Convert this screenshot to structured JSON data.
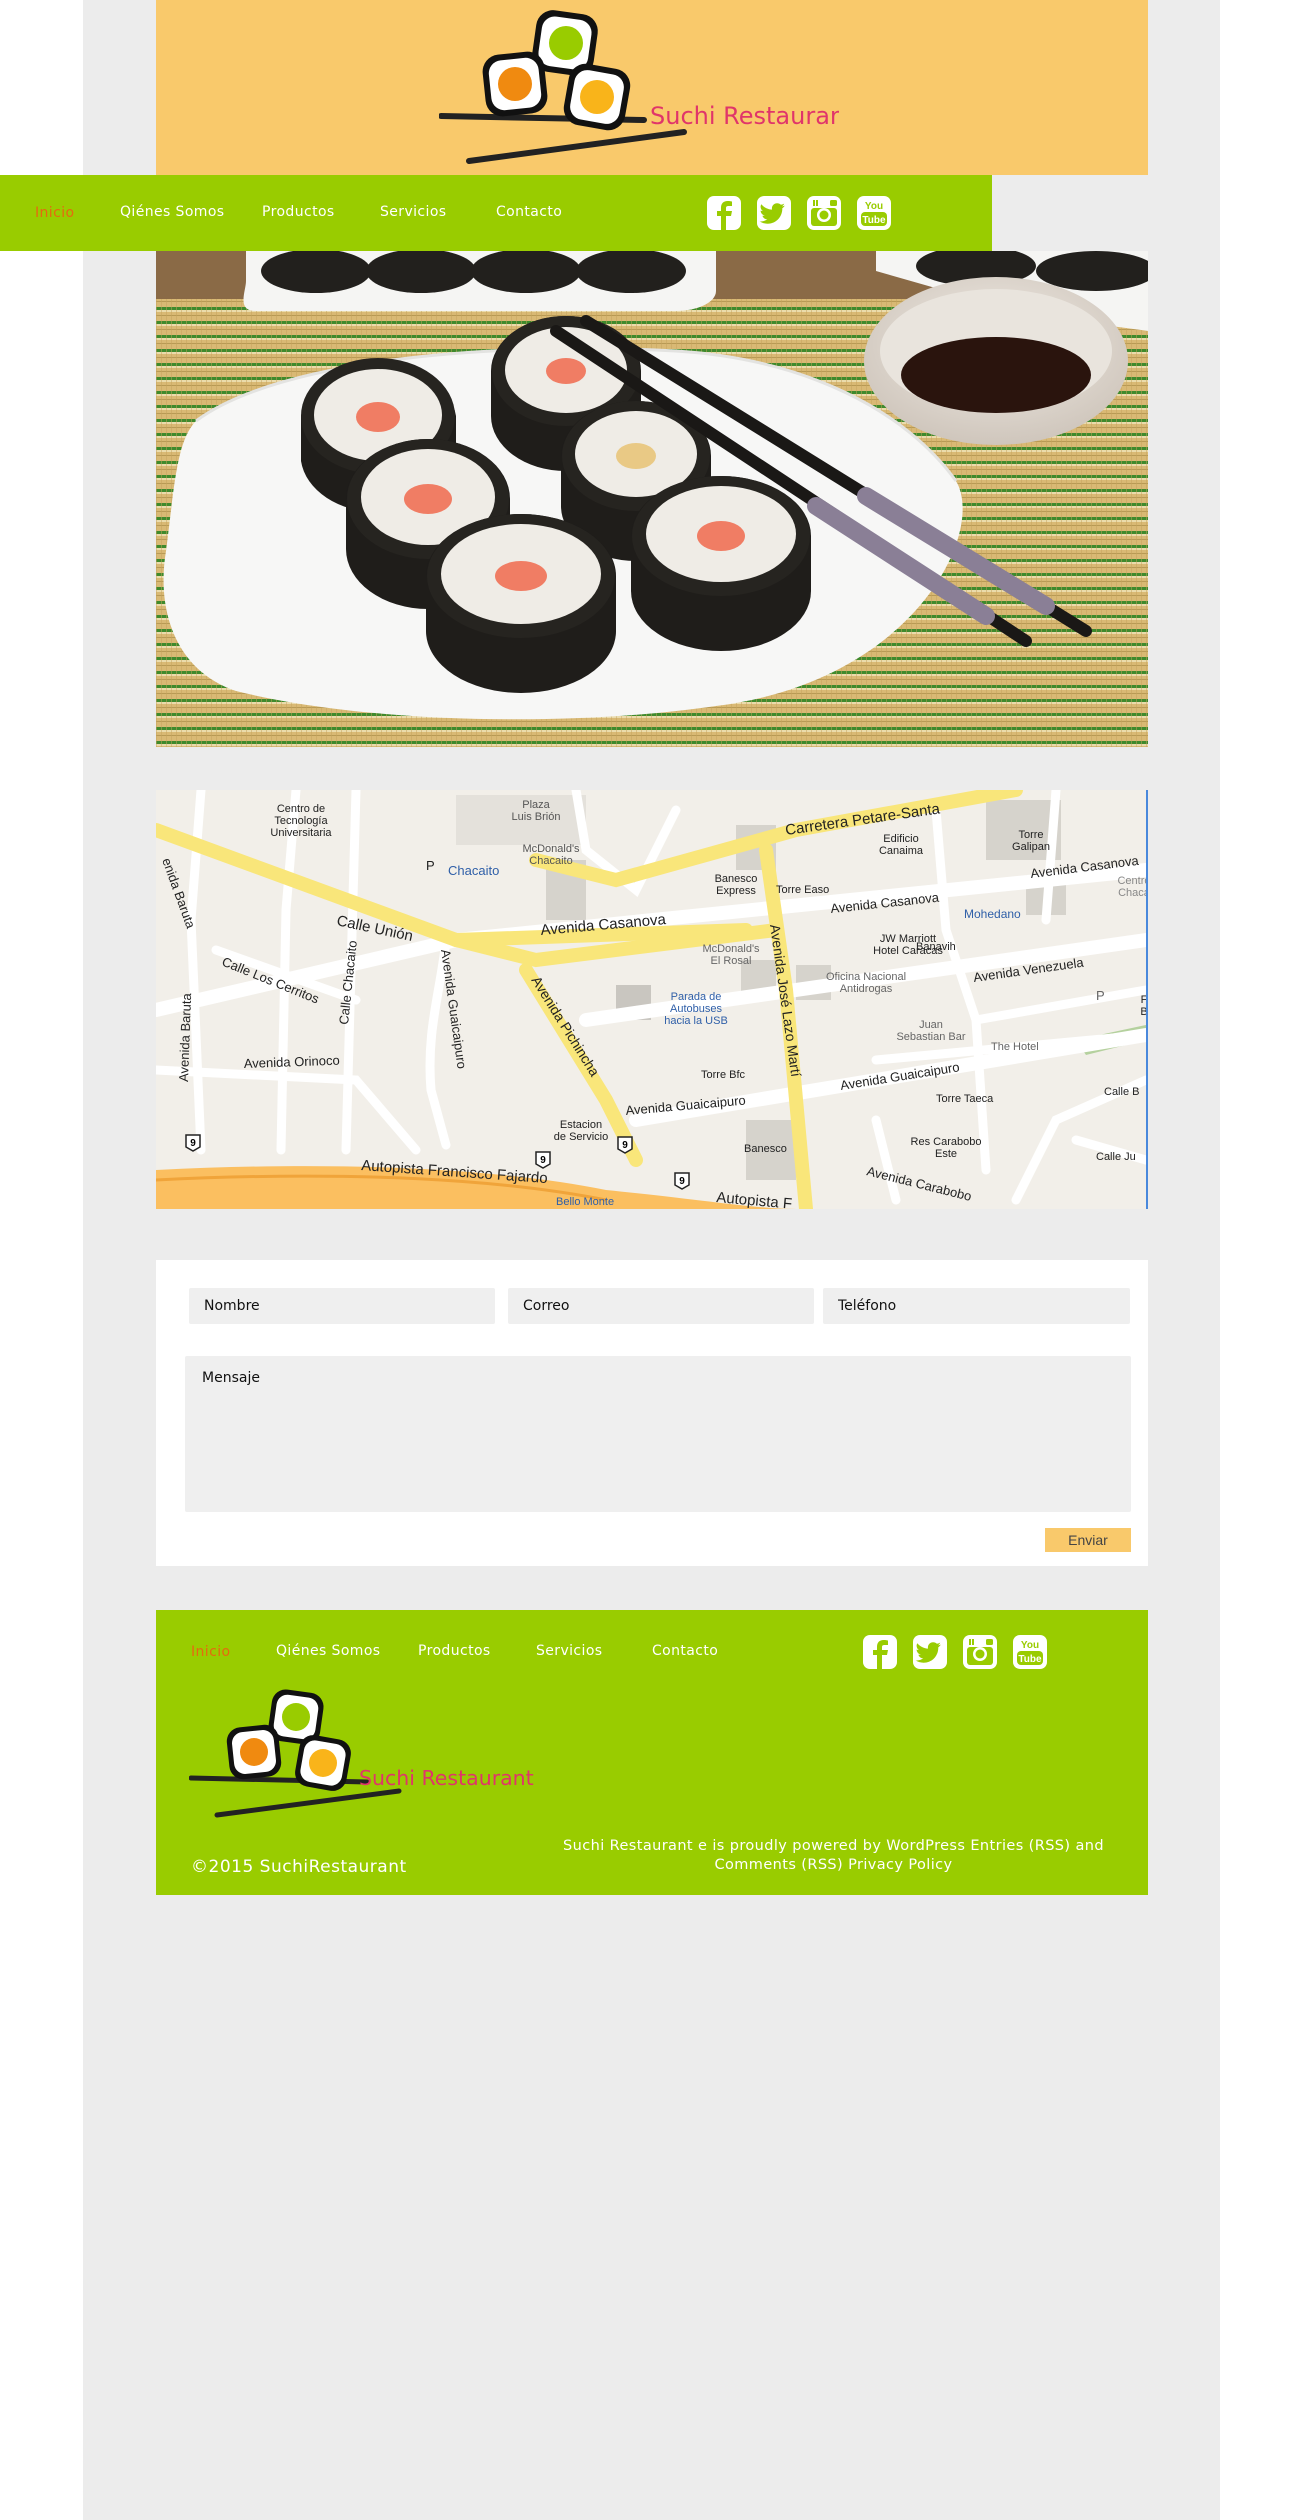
{
  "brand": {
    "name": "Suchi Restaurant",
    "colors": {
      "header": "#f9c96b",
      "nav": "#99cc00",
      "active": "#e56a0f",
      "logo_text": "#e0356a"
    }
  },
  "nav": {
    "items": [
      {
        "label": "Inicio",
        "active": true
      },
      {
        "label": "Qiénes Somos"
      },
      {
        "label": "Productos"
      },
      {
        "label": "Servicios"
      },
      {
        "label": "Contacto"
      }
    ],
    "social": [
      "facebook-icon",
      "twitter-icon",
      "instagram-icon",
      "youtube-icon"
    ],
    "youtube_text": {
      "line1": "You",
      "line2": "Tube"
    }
  },
  "hero": {
    "icon": "sushi-photo"
  },
  "map": {
    "labels": {
      "calle_union": "Calle Unión",
      "av_casanova": "Avenida Casanova",
      "av_casanova_2": "Avenida Casanova",
      "av_casanova_3": "Avenida Casanova",
      "av_jose_lazo": "Avenida José Lazo Martí",
      "av_pichincha": "Avenida Pichincha",
      "av_guaicaipuro": "Avenida Guaicaipuro",
      "av_guaicaipuro_2": "Avenida Guaicaipuro",
      "av_guaicaipuro_3": "Avenida Guaicaipuro",
      "autopista": "Autopista Francisco Fajardo",
      "autopista_2": "Autopista F",
      "av_orinoco": "Avenida Orinoco",
      "av_venezuela": "Avenida Venezuela",
      "av_carabobo": "Avenida Carabobo",
      "av_baruta": "Avenida Baruta",
      "av_baruta_2": "enida Baruta",
      "calle_cerritos": "Calle Los Cerritos",
      "calle_chacaito": "Calle Chacaito",
      "carretera": "Carretera Petare-Santa",
      "chacaito": "Chacaito",
      "mcdonalds_chacaito": "McDonald's\nChacaito",
      "plaza": "Plaza\nLuis Brión",
      "centro_tec": "Centro de\nTecnología\nUniversitaria",
      "banesco_express": "Banesco\nExpress",
      "torre_easo": "Torre Easo",
      "edificio": "Edificio\nCanaima",
      "torre_galipan": "Torre\nGalipan",
      "mohedano": "Mohedano",
      "jw": "JW Marriott\nHotel Caracas",
      "mcdonalds_rosal": "McDonald's\nEl Rosal",
      "oficina": "Oficina Nacional\nAntidrogas",
      "banavih": "Banavih",
      "parada": "Parada de\nAutobuses\nhacia la USB",
      "juan": "Juan\nSebastian Bar",
      "the_hotel": "The Hotel",
      "torre_bfc": "Torre Bfc",
      "torre_taeca": "Torre Taeca",
      "estacion": "Estacion\nde Servicio",
      "banesco": "Banesco",
      "res_carabobo": "Res Carabobo\nEste",
      "bello_monte": "Bello Monte",
      "calle_ju": "Calle Ju",
      "calle_b": "Calle B",
      "centro_chaca": "Centro\nChaca",
      "partial_1": "F\nB",
      "road_sign": "9",
      "parking": "P"
    }
  },
  "contact": {
    "name_placeholder": "Nombre",
    "email_placeholder": "Correo",
    "phone_placeholder": "Teléfono",
    "message_placeholder": "Mensaje",
    "send_label": "Enviar"
  },
  "footer": {
    "copyright": "©2015 SuchiRestaurant",
    "powered": "Suchi Restaurant e is proudly powered by WordPress Entries (RSS) and Comments (RSS) Privacy Policy"
  }
}
